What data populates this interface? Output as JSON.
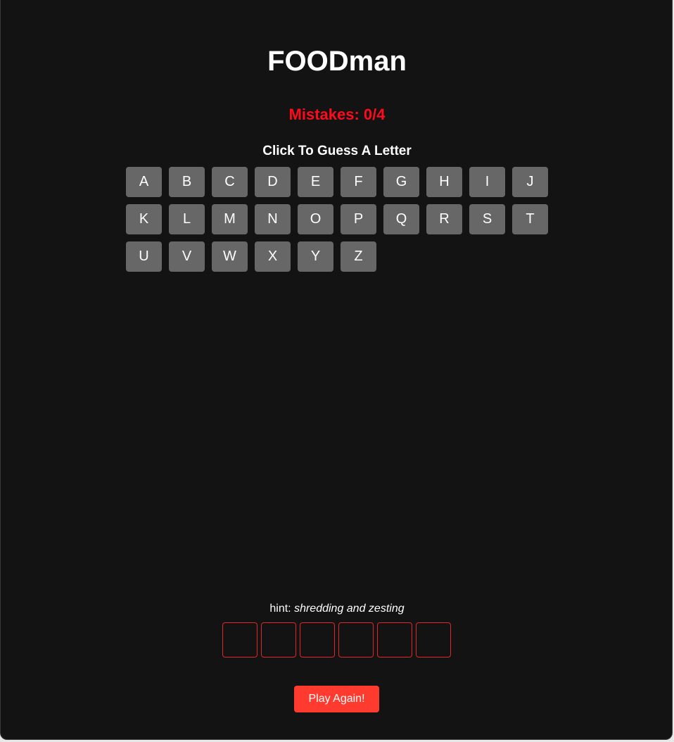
{
  "game": {
    "title": "FOODman",
    "mistakes_text": "Mistakes: 0/4",
    "instruction": "Click To Guess A Letter",
    "letters": [
      "A",
      "B",
      "C",
      "D",
      "E",
      "F",
      "G",
      "H",
      "I",
      "J",
      "K",
      "L",
      "M",
      "N",
      "O",
      "P",
      "Q",
      "R",
      "S",
      "T",
      "U",
      "V",
      "W",
      "X",
      "Y",
      "Z"
    ],
    "hint_label": "hint:",
    "hint_text": "shredding and zesting",
    "word_slots": [
      "",
      "",
      "",
      "",
      "",
      ""
    ],
    "play_again_label": "Play Again!"
  },
  "colors": {
    "background": "#131313",
    "mistakes": "#ff0a1c",
    "key": "#676767",
    "slot_border": "#e0262a",
    "button": "#ff3b30"
  }
}
